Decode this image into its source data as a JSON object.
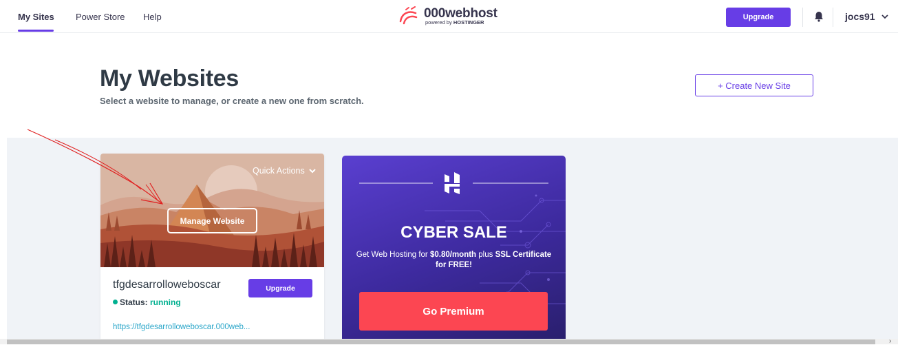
{
  "topbar": {
    "nav": [
      {
        "label": "My Sites",
        "active": true
      },
      {
        "label": "Power Store",
        "active": false
      },
      {
        "label": "Help",
        "active": false
      }
    ],
    "logo_text": "000webhost",
    "logo_sub_prefix": "powered by",
    "logo_sub_brand": "HOSTINGER",
    "upgrade_label": "Upgrade",
    "username": "jocs91"
  },
  "header": {
    "title": "My Websites",
    "subtitle": "Select a website to manage, or create a new one from scratch.",
    "create_label": "+ Create New Site"
  },
  "site_card": {
    "quick_actions_label": "Quick Actions",
    "manage_label": "Manage Website",
    "site_name": "tfgdesarrolloweboscar",
    "upgrade_label": "Upgrade",
    "status_label": "Status:",
    "status_value": "running",
    "url": "https://tfgdesarrolloweboscar.000web..."
  },
  "promo_card": {
    "title": "CYBER SALE",
    "text_part1": "Get Web Hosting for",
    "price": "$0.80/month",
    "text_part2": "plus",
    "ssl": "SSL Certificate for FREE!",
    "cta_label": "Go Premium"
  },
  "colors": {
    "accent": "#673de6",
    "status_green": "#00b090",
    "link": "#2aa6c9",
    "premium_red": "#fc4652",
    "promo_purple": "#4a34b8"
  },
  "icons": [
    "bell-icon",
    "chevron-down-icon",
    "hostinger-logo-icon",
    "webhost-logo-icon"
  ]
}
